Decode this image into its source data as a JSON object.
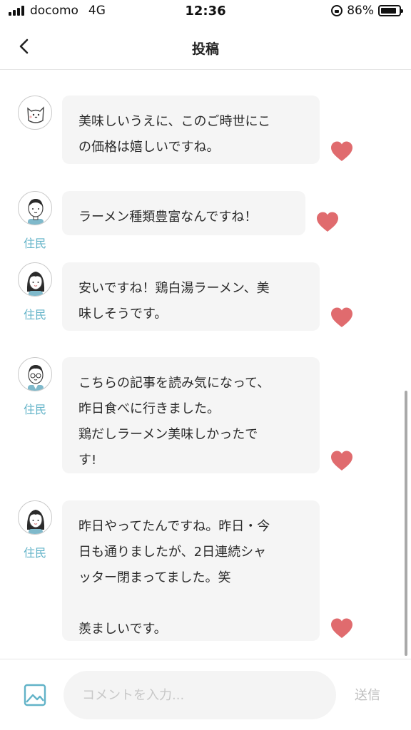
{
  "status_bar": {
    "carrier": "docomo",
    "network": "4G",
    "time": "12:36",
    "battery": "86%",
    "battery_level": 0.86
  },
  "header": {
    "title": "投稿",
    "back_icon": "chevron-left-icon"
  },
  "comments": [
    {
      "avatar": "cat-avatar",
      "role": "",
      "text": "美味しいうえに、このご時世にこ\nの価格は嬉しいですね。",
      "liked": true
    },
    {
      "avatar": "man-avatar",
      "role": "住民",
      "text": "ラーメン種類豊富なんですね！",
      "liked": true
    },
    {
      "avatar": "woman-avatar",
      "role": "住民",
      "text": "安いですね！鶏白湯ラーメン、美\n味しそうです。",
      "liked": true
    },
    {
      "avatar": "man-glasses-avatar",
      "role": "住民",
      "text": "こちらの記事を読み気になって、\n昨日食べに行きました。\n鶏だしラーメン美味しかったで\nす!",
      "liked": true
    },
    {
      "avatar": "woman-avatar",
      "role": "住民",
      "text": "昨日やってたんですね。昨日・今\n日も通りましたが、2日連続シャ\nッター閉まってました。笑\n\n羨ましいです。",
      "liked": true
    }
  ],
  "colors": {
    "heart": "#e06b6e",
    "role_label": "#62b3c8",
    "bubble": "#f5f5f5",
    "image_icon": "#62b3c8"
  },
  "composer": {
    "placeholder": "コメントを入力...",
    "value": "",
    "send_label": "送信",
    "image_icon": "image-icon"
  }
}
